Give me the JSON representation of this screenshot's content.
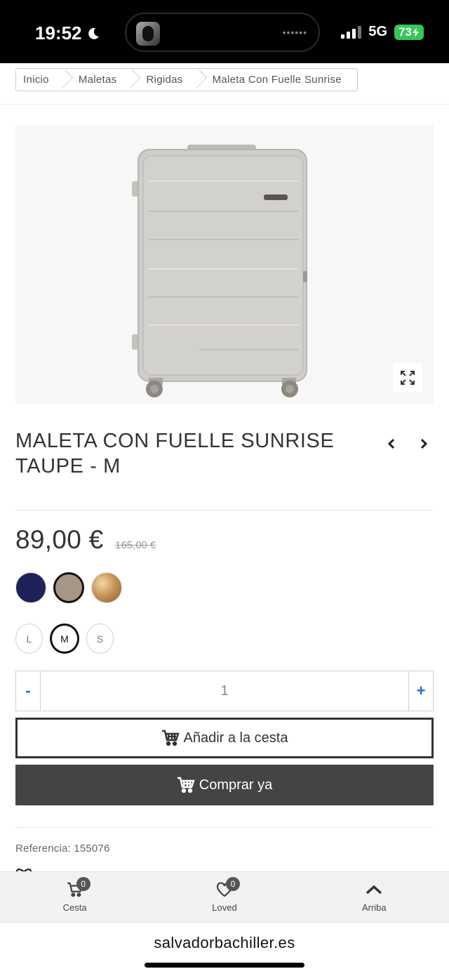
{
  "status_bar": {
    "time": "19:52",
    "network": "5G",
    "battery": "73",
    "island_dots": "••••••"
  },
  "breadcrumb": [
    {
      "label": "Inicio"
    },
    {
      "label": "Maletas"
    },
    {
      "label": "Rigidas"
    },
    {
      "label": "Maleta Con Fuelle Sunrise"
    }
  ],
  "product": {
    "title": "MALETA CON FUELLE SUNRISE TAUPE - M",
    "price": "89,00 €",
    "old_price": "165,00 €",
    "colors": [
      {
        "name": "navy",
        "hex": "#1f2258",
        "selected": false
      },
      {
        "name": "taupe",
        "hex": "#a59785",
        "selected": true
      },
      {
        "name": "gold",
        "hex": "#c8955a",
        "selected": false
      }
    ],
    "sizes": [
      {
        "label": "L",
        "selected": false
      },
      {
        "label": "M",
        "selected": true
      },
      {
        "label": "S",
        "selected": false
      }
    ],
    "quantity": {
      "minus": "-",
      "value": "1",
      "plus": "+"
    },
    "add_to_cart_label": "Añadir a la cesta",
    "buy_now_label": "Comprar ya",
    "reference": "Referencia: 155076"
  },
  "bottom_nav": [
    {
      "label": "Cesta",
      "badge": "0",
      "icon": "cart-icon"
    },
    {
      "label": "Loved",
      "badge": "0",
      "icon": "heart-icon"
    },
    {
      "label": "Arriba",
      "badge": "",
      "icon": "chevron-up-icon"
    }
  ],
  "browser": {
    "url": "salvadorbachiller.es"
  },
  "colors": {
    "accent_blue": "#1c6fc4",
    "buy_button": "#444444",
    "battery": "#35c759"
  }
}
